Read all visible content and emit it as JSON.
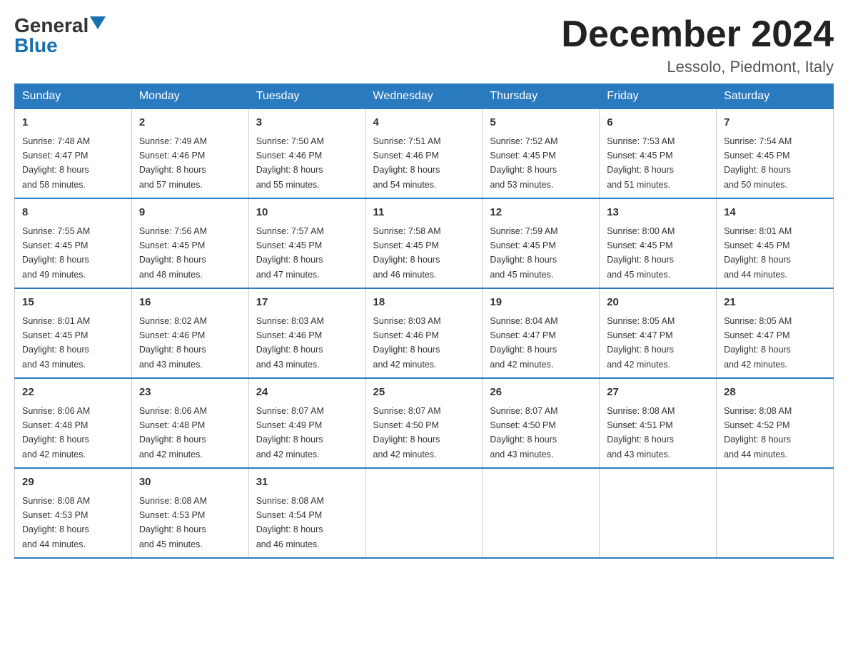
{
  "header": {
    "logo_general": "General",
    "logo_blue": "Blue",
    "month_title": "December 2024",
    "location": "Lessolo, Piedmont, Italy"
  },
  "days_of_week": [
    "Sunday",
    "Monday",
    "Tuesday",
    "Wednesday",
    "Thursday",
    "Friday",
    "Saturday"
  ],
  "weeks": [
    [
      {
        "day": "1",
        "sunrise": "7:48 AM",
        "sunset": "4:47 PM",
        "daylight": "8 hours and 58 minutes."
      },
      {
        "day": "2",
        "sunrise": "7:49 AM",
        "sunset": "4:46 PM",
        "daylight": "8 hours and 57 minutes."
      },
      {
        "day": "3",
        "sunrise": "7:50 AM",
        "sunset": "4:46 PM",
        "daylight": "8 hours and 55 minutes."
      },
      {
        "day": "4",
        "sunrise": "7:51 AM",
        "sunset": "4:46 PM",
        "daylight": "8 hours and 54 minutes."
      },
      {
        "day": "5",
        "sunrise": "7:52 AM",
        "sunset": "4:45 PM",
        "daylight": "8 hours and 53 minutes."
      },
      {
        "day": "6",
        "sunrise": "7:53 AM",
        "sunset": "4:45 PM",
        "daylight": "8 hours and 51 minutes."
      },
      {
        "day": "7",
        "sunrise": "7:54 AM",
        "sunset": "4:45 PM",
        "daylight": "8 hours and 50 minutes."
      }
    ],
    [
      {
        "day": "8",
        "sunrise": "7:55 AM",
        "sunset": "4:45 PM",
        "daylight": "8 hours and 49 minutes."
      },
      {
        "day": "9",
        "sunrise": "7:56 AM",
        "sunset": "4:45 PM",
        "daylight": "8 hours and 48 minutes."
      },
      {
        "day": "10",
        "sunrise": "7:57 AM",
        "sunset": "4:45 PM",
        "daylight": "8 hours and 47 minutes."
      },
      {
        "day": "11",
        "sunrise": "7:58 AM",
        "sunset": "4:45 PM",
        "daylight": "8 hours and 46 minutes."
      },
      {
        "day": "12",
        "sunrise": "7:59 AM",
        "sunset": "4:45 PM",
        "daylight": "8 hours and 45 minutes."
      },
      {
        "day": "13",
        "sunrise": "8:00 AM",
        "sunset": "4:45 PM",
        "daylight": "8 hours and 45 minutes."
      },
      {
        "day": "14",
        "sunrise": "8:01 AM",
        "sunset": "4:45 PM",
        "daylight": "8 hours and 44 minutes."
      }
    ],
    [
      {
        "day": "15",
        "sunrise": "8:01 AM",
        "sunset": "4:45 PM",
        "daylight": "8 hours and 43 minutes."
      },
      {
        "day": "16",
        "sunrise": "8:02 AM",
        "sunset": "4:46 PM",
        "daylight": "8 hours and 43 minutes."
      },
      {
        "day": "17",
        "sunrise": "8:03 AM",
        "sunset": "4:46 PM",
        "daylight": "8 hours and 43 minutes."
      },
      {
        "day": "18",
        "sunrise": "8:03 AM",
        "sunset": "4:46 PM",
        "daylight": "8 hours and 42 minutes."
      },
      {
        "day": "19",
        "sunrise": "8:04 AM",
        "sunset": "4:47 PM",
        "daylight": "8 hours and 42 minutes."
      },
      {
        "day": "20",
        "sunrise": "8:05 AM",
        "sunset": "4:47 PM",
        "daylight": "8 hours and 42 minutes."
      },
      {
        "day": "21",
        "sunrise": "8:05 AM",
        "sunset": "4:47 PM",
        "daylight": "8 hours and 42 minutes."
      }
    ],
    [
      {
        "day": "22",
        "sunrise": "8:06 AM",
        "sunset": "4:48 PM",
        "daylight": "8 hours and 42 minutes."
      },
      {
        "day": "23",
        "sunrise": "8:06 AM",
        "sunset": "4:48 PM",
        "daylight": "8 hours and 42 minutes."
      },
      {
        "day": "24",
        "sunrise": "8:07 AM",
        "sunset": "4:49 PM",
        "daylight": "8 hours and 42 minutes."
      },
      {
        "day": "25",
        "sunrise": "8:07 AM",
        "sunset": "4:50 PM",
        "daylight": "8 hours and 42 minutes."
      },
      {
        "day": "26",
        "sunrise": "8:07 AM",
        "sunset": "4:50 PM",
        "daylight": "8 hours and 43 minutes."
      },
      {
        "day": "27",
        "sunrise": "8:08 AM",
        "sunset": "4:51 PM",
        "daylight": "8 hours and 43 minutes."
      },
      {
        "day": "28",
        "sunrise": "8:08 AM",
        "sunset": "4:52 PM",
        "daylight": "8 hours and 44 minutes."
      }
    ],
    [
      {
        "day": "29",
        "sunrise": "8:08 AM",
        "sunset": "4:53 PM",
        "daylight": "8 hours and 44 minutes."
      },
      {
        "day": "30",
        "sunrise": "8:08 AM",
        "sunset": "4:53 PM",
        "daylight": "8 hours and 45 minutes."
      },
      {
        "day": "31",
        "sunrise": "8:08 AM",
        "sunset": "4:54 PM",
        "daylight": "8 hours and 46 minutes."
      },
      null,
      null,
      null,
      null
    ]
  ],
  "labels": {
    "sunrise": "Sunrise:",
    "sunset": "Sunset:",
    "daylight": "Daylight:"
  }
}
